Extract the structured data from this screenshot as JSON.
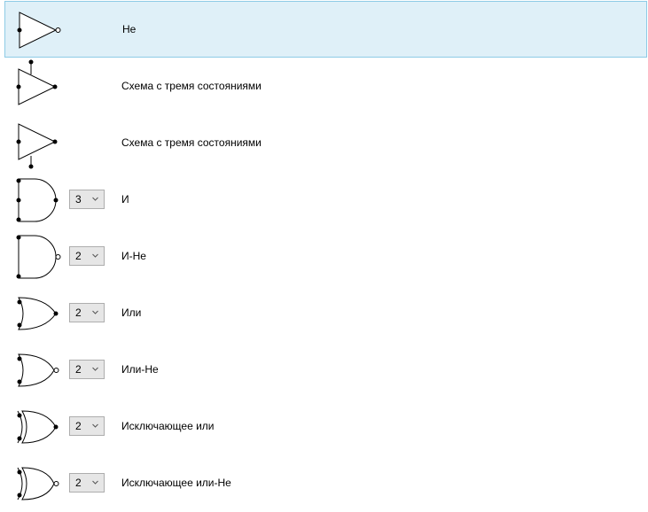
{
  "gates": [
    {
      "type": "not",
      "label": "Не",
      "selected": true
    },
    {
      "type": "tristate-top",
      "label": "Схема с тремя состояниями",
      "selected": false
    },
    {
      "type": "tristate-bottom",
      "label": "Схема с тремя состояниями",
      "selected": false
    },
    {
      "type": "and",
      "label": "И",
      "inputs": "3",
      "selected": false
    },
    {
      "type": "nand",
      "label": "И-Не",
      "inputs": "2",
      "selected": false
    },
    {
      "type": "or",
      "label": "Или",
      "inputs": "2",
      "selected": false
    },
    {
      "type": "nor",
      "label": "Или-Не",
      "inputs": "2",
      "selected": false
    },
    {
      "type": "xor",
      "label": "Исключающее или",
      "inputs": "2",
      "selected": false
    },
    {
      "type": "xnor",
      "label": "Исключающее или-Не",
      "inputs": "2",
      "selected": false
    }
  ],
  "icons": {
    "not": "not-gate-icon",
    "tristate-top": "tristate-buffer-icon",
    "tristate-bottom": "tristate-buffer-icon",
    "and": "and-gate-icon",
    "nand": "nand-gate-icon",
    "or": "or-gate-icon",
    "nor": "nor-gate-icon",
    "xor": "xor-gate-icon",
    "xnor": "xnor-gate-icon"
  },
  "colors": {
    "selection_background": "#dff0f8",
    "selection_border": "#8ecbe6",
    "combo_background": "#e6e6e6"
  }
}
